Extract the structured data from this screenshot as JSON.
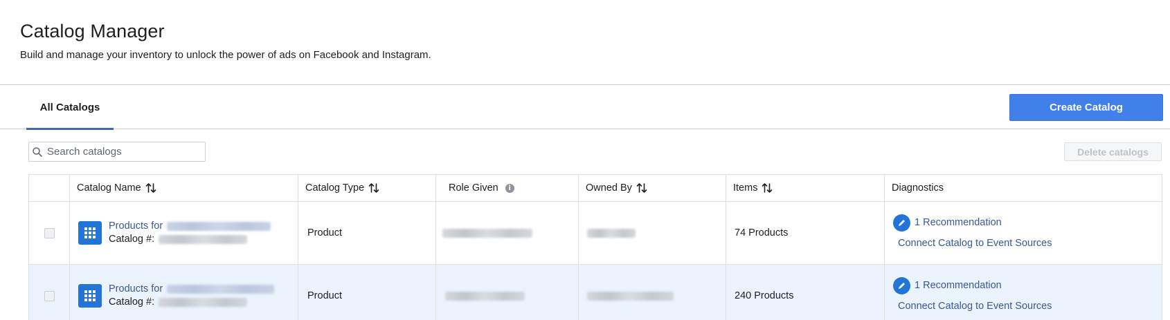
{
  "header": {
    "title": "Catalog Manager",
    "subtitle": "Build and manage your inventory to unlock the power of ads on Facebook and Instagram."
  },
  "tabs": [
    {
      "label": "All Catalogs",
      "active": true
    }
  ],
  "toolbar": {
    "create_label": "Create Catalog",
    "delete_label": "Delete catalogs",
    "search_placeholder": "Search catalogs"
  },
  "table": {
    "columns": [
      "Catalog Name",
      "Catalog Type",
      "Role Given",
      "Owned By",
      "Items",
      "Diagnostics"
    ],
    "rows": [
      {
        "name_prefix": "Products for",
        "catalog_no_label": "Catalog #:",
        "type": "Product",
        "items": "74 Products",
        "recommendation": "1 Recommendation",
        "connect_label": "Connect Catalog to Event Sources",
        "selected": false
      },
      {
        "name_prefix": "Products for",
        "catalog_no_label": "Catalog #:",
        "type": "Product",
        "items": "240 Products",
        "recommendation": "1 Recommendation",
        "connect_label": "Connect Catalog to Event Sources",
        "selected": true
      }
    ]
  },
  "colors": {
    "accent": "#4080e8",
    "link": "#385898",
    "selected_row": "#ebf3fc"
  }
}
